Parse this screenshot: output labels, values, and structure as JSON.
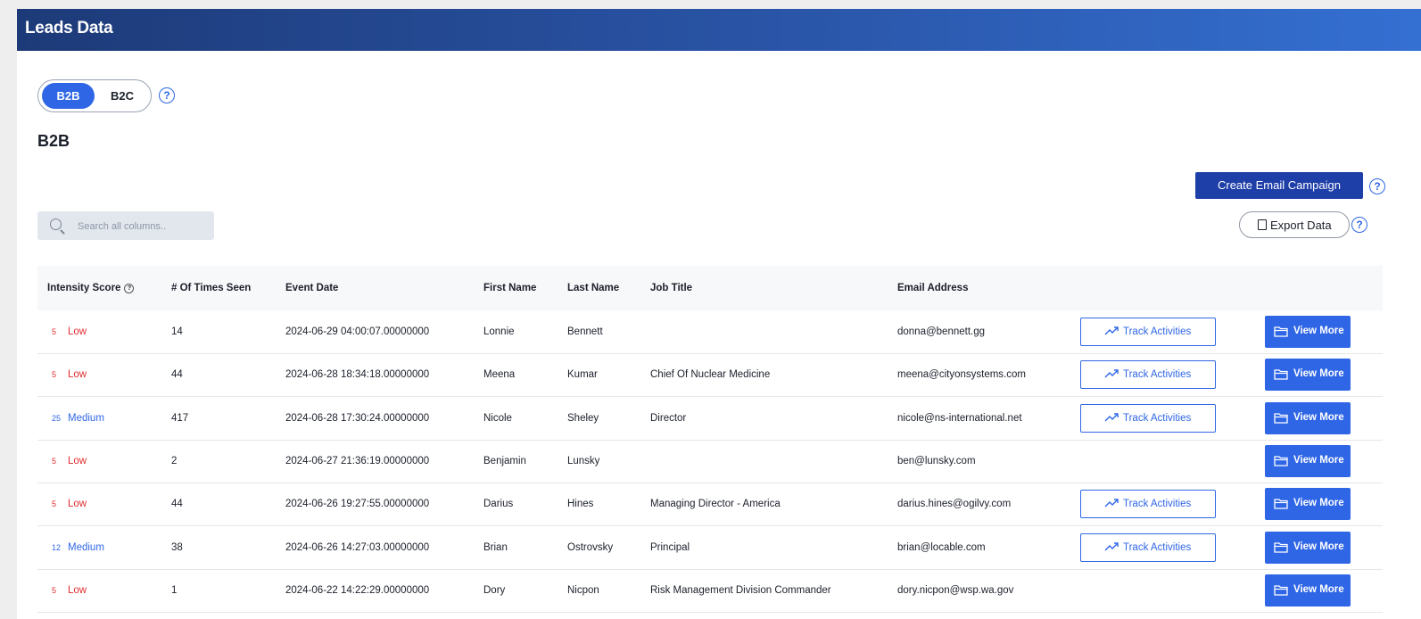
{
  "header": {
    "title": "Leads Data"
  },
  "toggle": {
    "b2b": "B2B",
    "b2c": "B2C",
    "help": "?"
  },
  "section_title": "B2B",
  "actions": {
    "create_email_campaign": "Create Email Campaign",
    "export_data": "Export Data",
    "help": "?"
  },
  "search": {
    "placeholder": "Search all columns.."
  },
  "table": {
    "columns": {
      "intensity": "Intensity Score",
      "times_seen": "# Of Times Seen",
      "event_date": "Event Date",
      "first_name": "First Name",
      "last_name": "Last Name",
      "job_title": "Job Title",
      "email": "Email Address"
    },
    "track_label": "Track Activities",
    "view_label": "View More",
    "rows": [
      {
        "score": "5",
        "level": "Low",
        "times": "14",
        "date": "2024-06-29 04:00:07.00000000",
        "first": "Lonnie",
        "last": "Bennett",
        "title": "",
        "email": "donna@bennett.gg",
        "track": true
      },
      {
        "score": "5",
        "level": "Low",
        "times": "44",
        "date": "2024-06-28 18:34:18.00000000",
        "first": "Meena",
        "last": "Kumar",
        "title": "Chief Of Nuclear Medicine",
        "email": "meena@cityonsystems.com",
        "track": true
      },
      {
        "score": "25",
        "level": "Medium",
        "times": "417",
        "date": "2024-06-28 17:30:24.00000000",
        "first": "Nicole",
        "last": "Sheley",
        "title": "Director",
        "email": "nicole@ns-international.net",
        "track": true
      },
      {
        "score": "5",
        "level": "Low",
        "times": "2",
        "date": "2024-06-27 21:36:19.00000000",
        "first": "Benjamin",
        "last": "Lunsky",
        "title": "",
        "email": "ben@lunsky.com",
        "track": false
      },
      {
        "score": "5",
        "level": "Low",
        "times": "44",
        "date": "2024-06-26 19:27:55.00000000",
        "first": "Darius",
        "last": "Hines",
        "title": "Managing Director - America",
        "email": "darius.hines@ogilvy.com",
        "track": true
      },
      {
        "score": "12",
        "level": "Medium",
        "times": "38",
        "date": "2024-06-26 14:27:03.00000000",
        "first": "Brian",
        "last": "Ostrovsky",
        "title": "Principal",
        "email": "brian@locable.com",
        "track": true
      },
      {
        "score": "5",
        "level": "Low",
        "times": "1",
        "date": "2024-06-22 14:22:29.00000000",
        "first": "Dory",
        "last": "Nicpon",
        "title": "Risk Management Division Commander",
        "email": "dory.nicpon@wsp.wa.gov",
        "track": false
      }
    ]
  }
}
